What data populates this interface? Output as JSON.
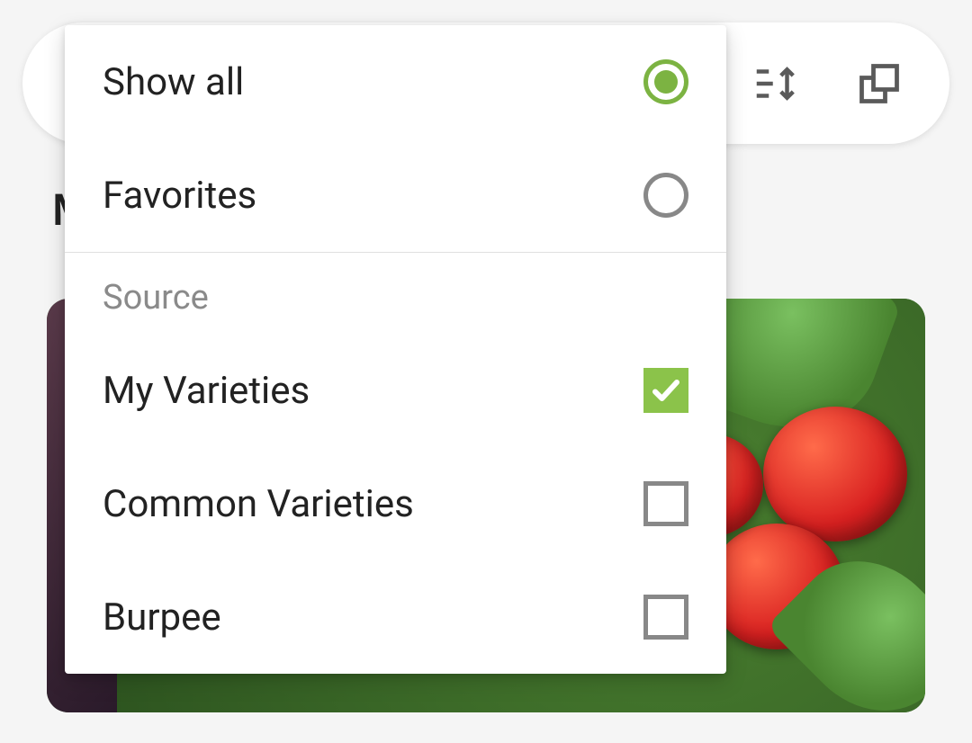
{
  "filter_panel": {
    "radios": [
      {
        "label": "Show all",
        "selected": true
      },
      {
        "label": "Favorites",
        "selected": false
      }
    ],
    "source_heading": "Source",
    "checkboxes": [
      {
        "label": "My Varieties",
        "checked": true
      },
      {
        "label": "Common Varieties",
        "checked": false
      },
      {
        "label": "Burpee",
        "checked": false
      }
    ]
  },
  "background": {
    "section_letter": "M"
  },
  "toolbar": {
    "sort_icon": "sort-icon",
    "resize_icon": "expand-icon"
  },
  "accent_color": "#8bc34a"
}
